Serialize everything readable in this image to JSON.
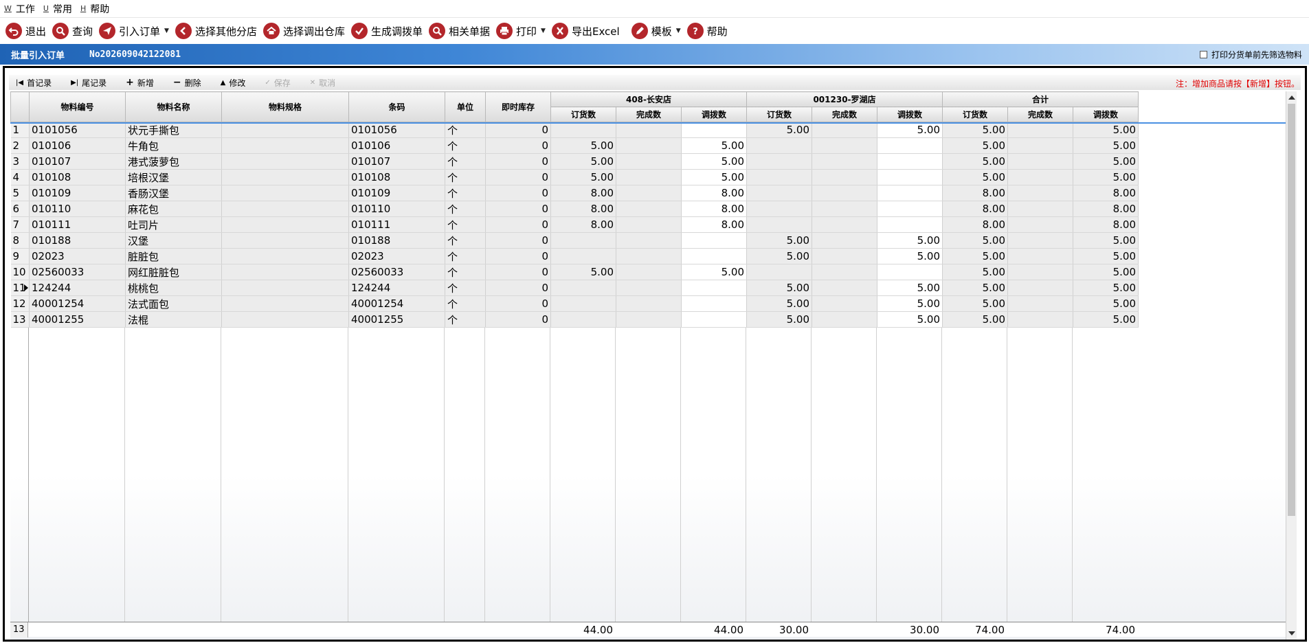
{
  "menubar": [
    {
      "accel": "W",
      "label": "工作"
    },
    {
      "accel": "U",
      "label": "常用"
    },
    {
      "accel": "H",
      "label": "帮助"
    }
  ],
  "toolbar": {
    "exit": "退出",
    "query": "查询",
    "import_order": "引入订单",
    "select_branch": "选择其他分店",
    "select_warehouse": "选择调出仓库",
    "gen_transfer": "生成调拨单",
    "related_docs": "相关单据",
    "print": "打印",
    "export_excel": "导出Excel",
    "template": "模板",
    "help": "帮助"
  },
  "titlebar": {
    "title": "批量引入订单",
    "order_no": "No202609042122081",
    "print_option": "打印分货单前先筛选物料"
  },
  "navbar": {
    "first": "首记录",
    "last": "尾记录",
    "add": "新增",
    "delete": "删除",
    "modify": "修改",
    "save": "保存",
    "cancel": "取消",
    "notice": "注：增加商品请按【新增】按钮。"
  },
  "grid": {
    "headers": {
      "code": "物料编号",
      "name": "物料名称",
      "spec": "物料规格",
      "barcode": "条码",
      "unit": "单位",
      "stock": "即时库存",
      "group1": "408-长安店",
      "group2": "001230-罗湖店",
      "group3": "合计",
      "order": "订货数",
      "done": "完成数",
      "transfer": "调拨数"
    },
    "rows": [
      {
        "n": "1",
        "code": "0101056",
        "name": "状元手撕包",
        "spec": "",
        "barcode": "0101056",
        "unit": "个",
        "stock": "0",
        "s1o": "",
        "s1d": "",
        "s1t": "",
        "s2o": "5.00",
        "s2d": "",
        "s2t": "5.00",
        "to": "5.00",
        "td": "",
        "tt": "5.00"
      },
      {
        "n": "2",
        "code": "010106",
        "name": "牛角包",
        "spec": "",
        "barcode": "010106",
        "unit": "个",
        "stock": "0",
        "s1o": "5.00",
        "s1d": "",
        "s1t": "5.00",
        "s2o": "",
        "s2d": "",
        "s2t": "",
        "to": "5.00",
        "td": "",
        "tt": "5.00"
      },
      {
        "n": "3",
        "code": "010107",
        "name": "港式菠萝包",
        "spec": "",
        "barcode": "010107",
        "unit": "个",
        "stock": "0",
        "s1o": "5.00",
        "s1d": "",
        "s1t": "5.00",
        "s2o": "",
        "s2d": "",
        "s2t": "",
        "to": "5.00",
        "td": "",
        "tt": "5.00"
      },
      {
        "n": "4",
        "code": "010108",
        "name": "培根汉堡",
        "spec": "",
        "barcode": "010108",
        "unit": "个",
        "stock": "0",
        "s1o": "5.00",
        "s1d": "",
        "s1t": "5.00",
        "s2o": "",
        "s2d": "",
        "s2t": "",
        "to": "5.00",
        "td": "",
        "tt": "5.00"
      },
      {
        "n": "5",
        "code": "010109",
        "name": "香肠汉堡",
        "spec": "",
        "barcode": "010109",
        "unit": "个",
        "stock": "0",
        "s1o": "8.00",
        "s1d": "",
        "s1t": "8.00",
        "s2o": "",
        "s2d": "",
        "s2t": "",
        "to": "8.00",
        "td": "",
        "tt": "8.00"
      },
      {
        "n": "6",
        "code": "010110",
        "name": "麻花包",
        "spec": "",
        "barcode": "010110",
        "unit": "个",
        "stock": "0",
        "s1o": "8.00",
        "s1d": "",
        "s1t": "8.00",
        "s2o": "",
        "s2d": "",
        "s2t": "",
        "to": "8.00",
        "td": "",
        "tt": "8.00"
      },
      {
        "n": "7",
        "code": "010111",
        "name": "吐司片",
        "spec": "",
        "barcode": "010111",
        "unit": "个",
        "stock": "0",
        "s1o": "8.00",
        "s1d": "",
        "s1t": "8.00",
        "s2o": "",
        "s2d": "",
        "s2t": "",
        "to": "8.00",
        "td": "",
        "tt": "8.00"
      },
      {
        "n": "8",
        "code": "010188",
        "name": "汉堡",
        "spec": "",
        "barcode": "010188",
        "unit": "个",
        "stock": "0",
        "s1o": "",
        "s1d": "",
        "s1t": "",
        "s2o": "5.00",
        "s2d": "",
        "s2t": "5.00",
        "to": "5.00",
        "td": "",
        "tt": "5.00"
      },
      {
        "n": "9",
        "code": "02023",
        "name": "脏脏包",
        "spec": "",
        "barcode": "02023",
        "unit": "个",
        "stock": "0",
        "s1o": "",
        "s1d": "",
        "s1t": "",
        "s2o": "5.00",
        "s2d": "",
        "s2t": "5.00",
        "to": "5.00",
        "td": "",
        "tt": "5.00"
      },
      {
        "n": "10",
        "code": "02560033",
        "name": "网红脏脏包",
        "spec": "",
        "barcode": "02560033",
        "unit": "个",
        "stock": "0",
        "s1o": "5.00",
        "s1d": "",
        "s1t": "5.00",
        "s2o": "",
        "s2d": "",
        "s2t": "",
        "to": "5.00",
        "td": "",
        "tt": "5.00"
      },
      {
        "n": "11",
        "code": "124244",
        "name": "桃桃包",
        "spec": "",
        "barcode": "124244",
        "unit": "个",
        "stock": "0",
        "s1o": "",
        "s1d": "",
        "s1t": "",
        "s2o": "5.00",
        "s2d": "",
        "s2t": "5.00",
        "to": "5.00",
        "td": "",
        "tt": "5.00",
        "current": true
      },
      {
        "n": "12",
        "code": "40001254",
        "name": "法式面包",
        "spec": "",
        "barcode": "40001254",
        "unit": "个",
        "stock": "0",
        "s1o": "",
        "s1d": "",
        "s1t": "",
        "s2o": "5.00",
        "s2d": "",
        "s2t": "5.00",
        "to": "5.00",
        "td": "",
        "tt": "5.00"
      },
      {
        "n": "13",
        "code": "40001255",
        "name": "法棍",
        "spec": "",
        "barcode": "40001255",
        "unit": "个",
        "stock": "0",
        "s1o": "",
        "s1d": "",
        "s1t": "",
        "s2o": "5.00",
        "s2d": "",
        "s2t": "5.00",
        "to": "5.00",
        "td": "",
        "tt": "5.00"
      }
    ],
    "footer": {
      "count": "13",
      "s1o": "44.00",
      "s1t": "44.00",
      "s2o": "30.00",
      "s2t": "30.00",
      "to": "74.00",
      "tt": "74.00"
    }
  }
}
